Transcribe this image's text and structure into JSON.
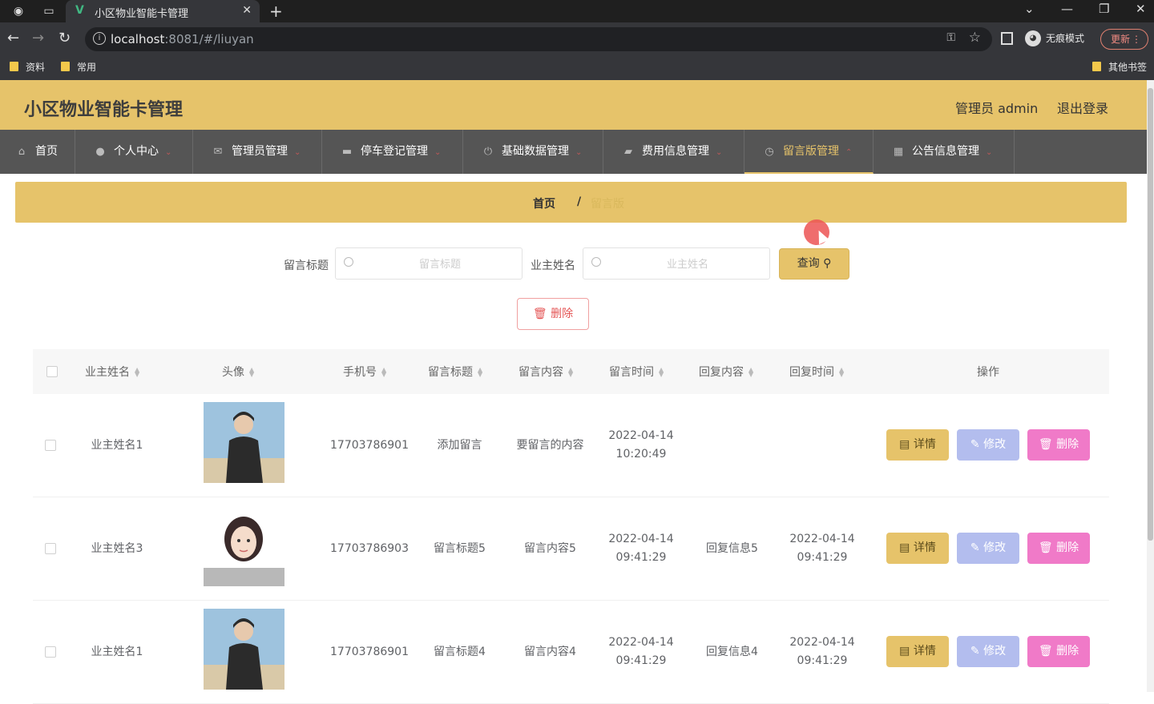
{
  "browser": {
    "tab_title": "小区物业智能卡管理",
    "url_host": "localhost",
    "url_rest": ":8081/#/liuyan",
    "incognito_label": "无痕模式",
    "update_label": "更新",
    "bookmarks": [
      "资料",
      "常用"
    ],
    "other_bookmarks": "其他书签"
  },
  "header": {
    "title": "小区物业智能卡管理",
    "admin": "管理员 admin",
    "logout": "退出登录"
  },
  "nav": [
    {
      "label": "首页",
      "icon": "home-icon"
    },
    {
      "label": "个人中心",
      "icon": "user-icon"
    },
    {
      "label": "管理员管理",
      "icon": "mail-icon"
    },
    {
      "label": "停车登记管理",
      "icon": "car-icon"
    },
    {
      "label": "基础数据管理",
      "icon": "power-icon"
    },
    {
      "label": "费用信息管理",
      "icon": "wallet-icon"
    },
    {
      "label": "留言版管理",
      "icon": "clock-icon"
    },
    {
      "label": "公告信息管理",
      "icon": "grid-icon"
    }
  ],
  "breadcrumb": {
    "home": "首页",
    "sep": "/",
    "current": "留言版"
  },
  "search": {
    "title_label": "留言标题",
    "title_placeholder": "留言标题",
    "owner_label": "业主姓名",
    "owner_placeholder": "业主姓名",
    "query_button": "查询"
  },
  "bulk_delete": "删除",
  "table": {
    "headers": [
      "业主姓名",
      "头像",
      "手机号",
      "留言标题",
      "留言内容",
      "留言时间",
      "回复内容",
      "回复时间",
      "操作"
    ],
    "rows": [
      {
        "name": "业主姓名1",
        "phone": "17703786901",
        "title": "添加留言",
        "content": "要留言的内容",
        "time": "2022-04-14 10:20:49",
        "reply": "",
        "reply_time": ""
      },
      {
        "name": "业主姓名3",
        "phone": "17703786903",
        "title": "留言标题5",
        "content": "留言内容5",
        "time": "2022-04-14 09:41:29",
        "reply": "回复信息5",
        "reply_time": "2022-04-14 09:41:29"
      },
      {
        "name": "业主姓名1",
        "phone": "17703786901",
        "title": "留言标题4",
        "content": "留言内容4",
        "time": "2022-04-14 09:41:29",
        "reply": "回复信息4",
        "reply_time": "2022-04-14 09:41:29"
      }
    ],
    "actions": {
      "detail": "详情",
      "edit": "修改",
      "delete": "删除"
    }
  },
  "colors": {
    "accent": "#e6c36a",
    "nav_bg": "#555555",
    "edit": "#b3bdee",
    "delete": "#f07ac8"
  }
}
